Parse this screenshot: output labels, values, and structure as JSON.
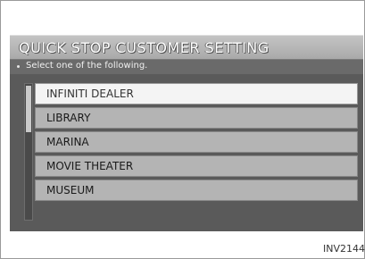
{
  "screen": {
    "title": "QUICK STOP CUSTOMER SETTING",
    "instruction": "Select one of the following.",
    "items": [
      {
        "label": "INFINITI DEALER",
        "selected": true
      },
      {
        "label": "LIBRARY",
        "selected": false
      },
      {
        "label": "MARINA",
        "selected": false
      },
      {
        "label": "MOVIE THEATER",
        "selected": false
      },
      {
        "label": "MUSEUM",
        "selected": false
      }
    ],
    "scrollbar": {
      "position_fraction": 0.0,
      "visible_fraction": 0.35
    }
  },
  "figure_ref": "INV2144"
}
